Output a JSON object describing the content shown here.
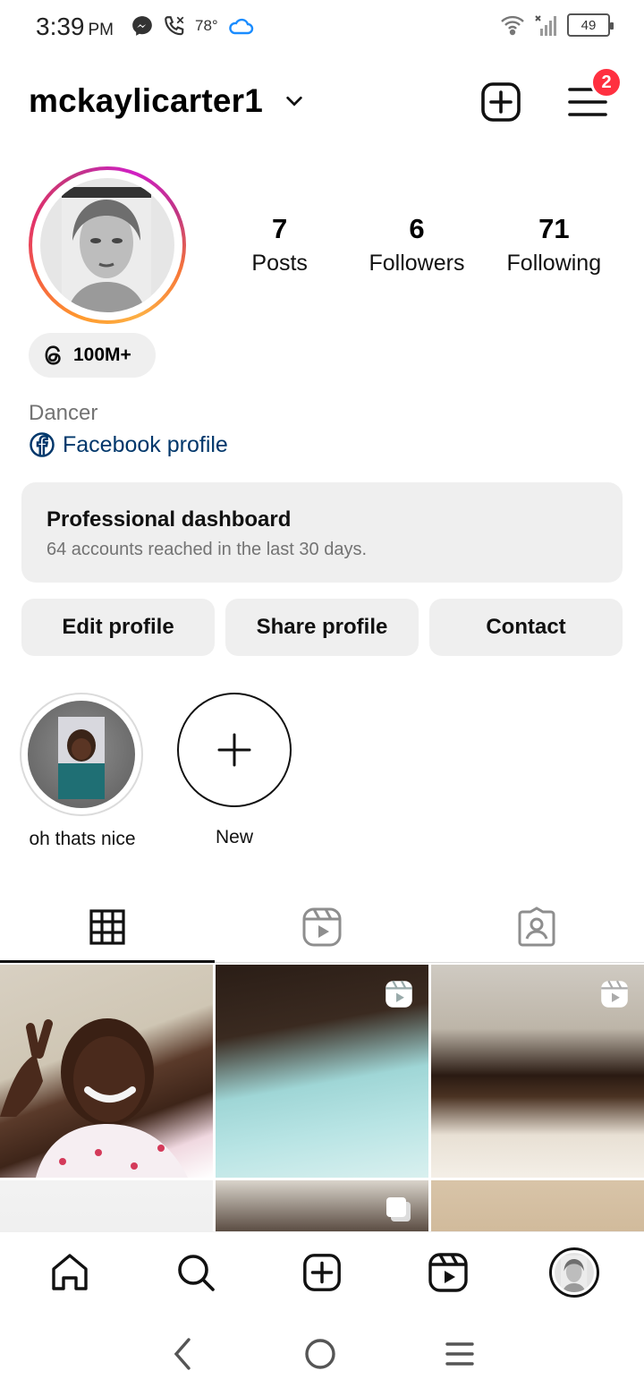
{
  "status_bar": {
    "time": "3:39",
    "ampm": "PM",
    "temperature": "78°",
    "battery": "49"
  },
  "header": {
    "username": "mckaylicarter1",
    "notification_count": "2"
  },
  "profile": {
    "stats": [
      {
        "value": "7",
        "label": "Posts"
      },
      {
        "value": "6",
        "label": "Followers"
      },
      {
        "value": "71",
        "label": "Following"
      }
    ],
    "threads_badge": "100M+",
    "category": "Dancer",
    "facebook_link": "Facebook profile"
  },
  "dashboard": {
    "title": "Professional dashboard",
    "subtitle": "64 accounts reached in the last 30 days."
  },
  "actions": {
    "edit": "Edit profile",
    "share": "Share profile",
    "contact": "Contact"
  },
  "highlights": [
    {
      "label": "oh thats nice"
    },
    {
      "label": "New"
    }
  ],
  "tabs": [
    {
      "icon": "grid-icon",
      "active": true
    },
    {
      "icon": "reels-icon",
      "active": false
    },
    {
      "icon": "tagged-icon",
      "active": false
    }
  ],
  "bottom_nav": [
    {
      "icon": "home-icon"
    },
    {
      "icon": "search-icon"
    },
    {
      "icon": "create-icon"
    },
    {
      "icon": "reels-icon"
    },
    {
      "icon": "profile-avatar"
    }
  ],
  "colors": {
    "accent_badge": "#ff3040",
    "link": "#00376b",
    "muted": "#737373",
    "button_bg": "#efefef"
  }
}
